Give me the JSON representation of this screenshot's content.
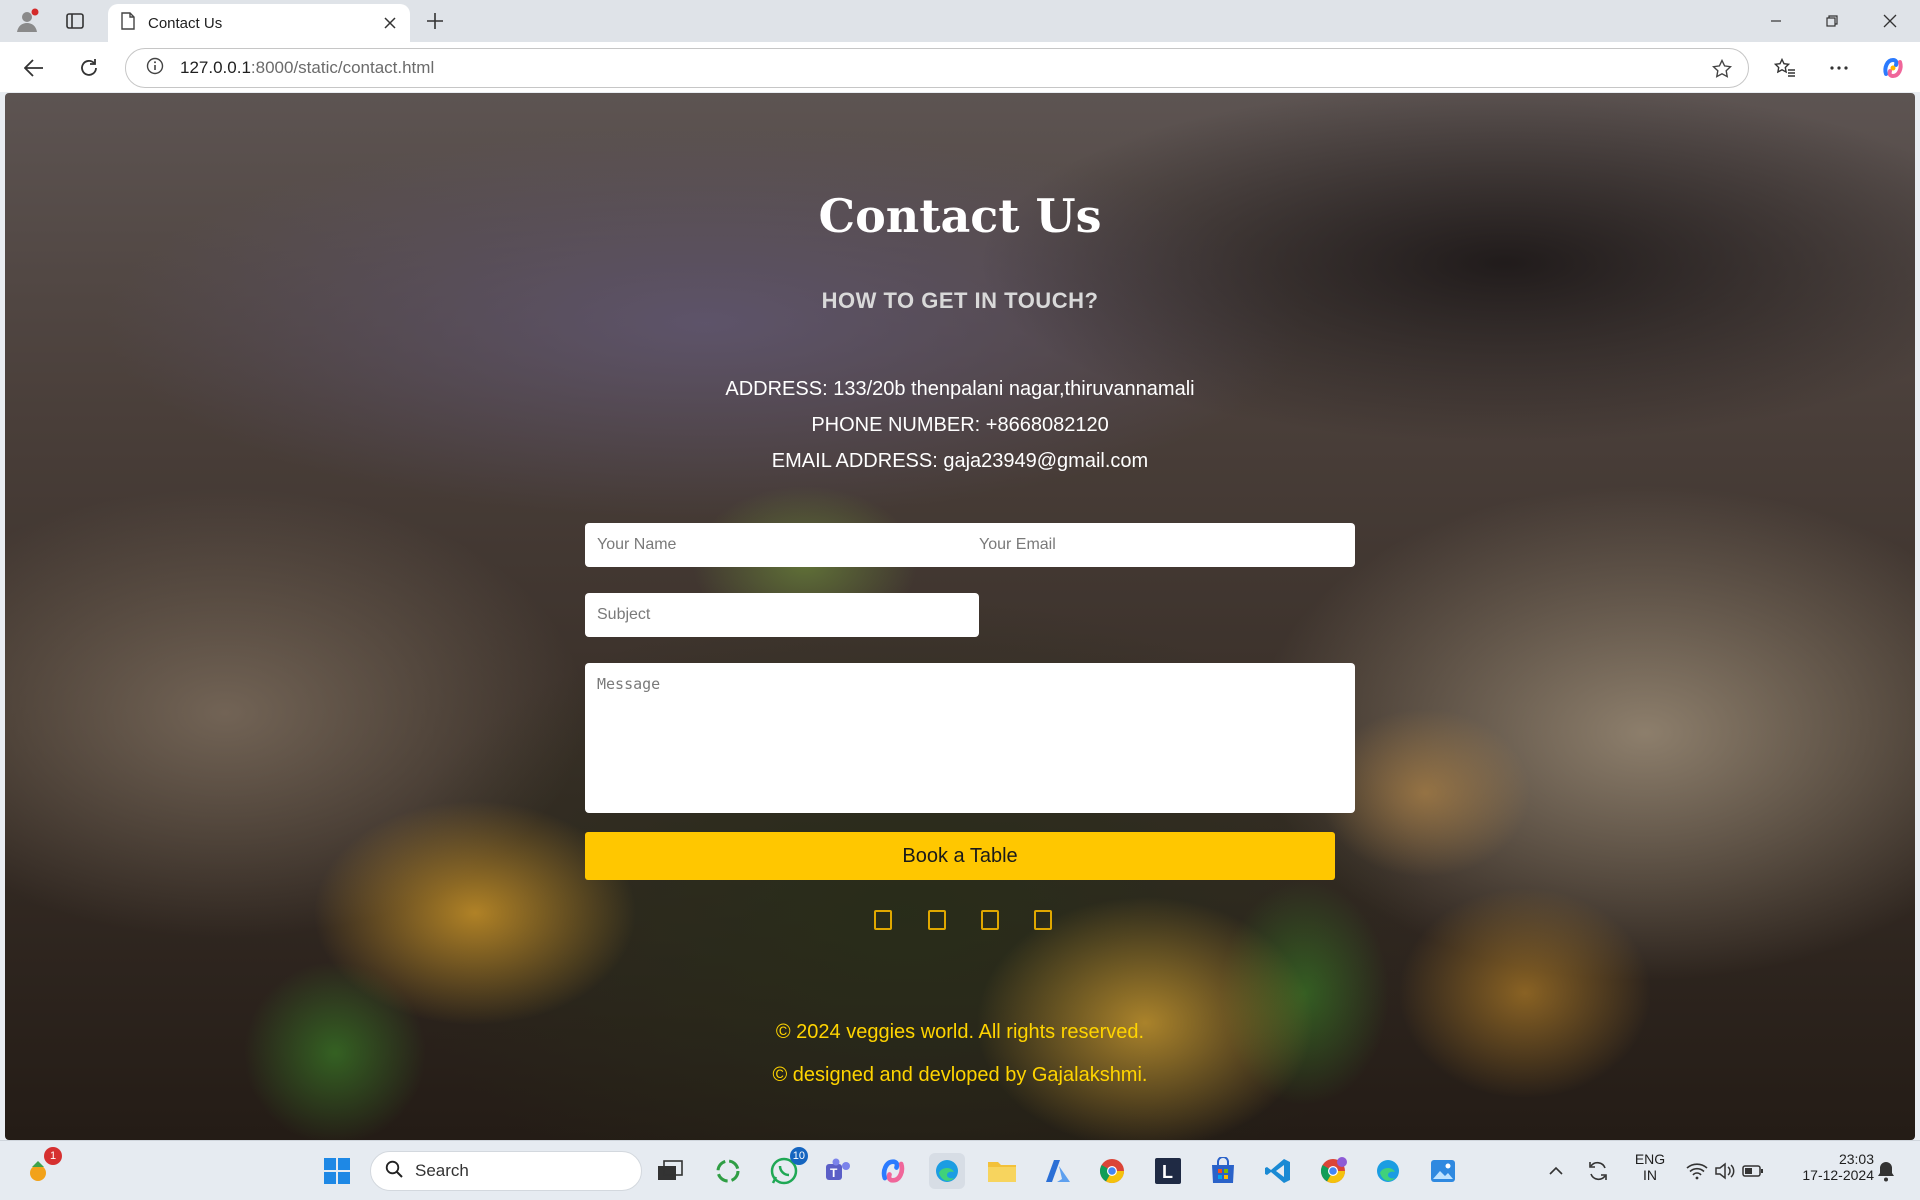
{
  "browser": {
    "tab_title": "Contact Us",
    "url_host": "127.0.0.1",
    "url_rest": ":8000/static/contact.html"
  },
  "page": {
    "title": "Contact Us",
    "subtitle": "HOW TO GET IN TOUCH?",
    "address": "ADDRESS: 133/20b thenpalani nagar,thiruvannamali",
    "phone": "PHONE NUMBER: +8668082120",
    "email": "EMAIL ADDRESS: gaja23949@gmail.com",
    "form": {
      "name_placeholder": "Your Name",
      "email_placeholder": "Your Email",
      "subject_placeholder": "Subject",
      "message_placeholder": "Message",
      "submit_label": "Book a Table"
    },
    "social_icons": [
      "social-icon-1",
      "social-icon-2",
      "social-icon-3",
      "social-icon-4"
    ],
    "footer": {
      "copyright": "© 2024 veggies world. All rights reserved.",
      "credit": "© designed and devloped by Gajalakshmi."
    },
    "colors": {
      "accent_button": "#ffc700",
      "footer_text": "#ffd400"
    }
  },
  "taskbar": {
    "search_label": "Search",
    "notification_badge": "1",
    "whatsapp_badge": "10",
    "language_line1": "ENG",
    "language_line2": "IN",
    "time": "23:03",
    "date": "17-12-2024"
  }
}
